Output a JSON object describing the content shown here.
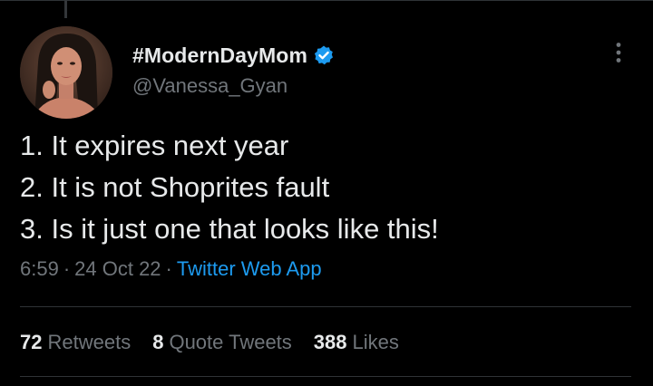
{
  "author": {
    "display_name": "#ModernDayMom",
    "handle": "@Vanessa_Gyan",
    "verified": true,
    "avatar": "profile-photo"
  },
  "tweet": {
    "lines": [
      "1. It expires next year",
      "2. It is not Shoprites fault",
      "3. Is it just one that looks like this!"
    ]
  },
  "meta": {
    "time": "6:59",
    "separator": "·",
    "date": "24 Oct 22",
    "source": "Twitter Web App"
  },
  "stats": {
    "retweets": {
      "count": "72",
      "label": "Retweets"
    },
    "quotes": {
      "count": "8",
      "label": "Quote Tweets"
    },
    "likes": {
      "count": "388",
      "label": "Likes"
    }
  },
  "icons": {
    "verified": "verified-badge-icon",
    "more": "more-options-icon"
  },
  "colors": {
    "background": "#000000",
    "text": "#e7e9ea",
    "secondary": "#71767b",
    "accent": "#1d9bf0",
    "divider": "#2f3336"
  }
}
